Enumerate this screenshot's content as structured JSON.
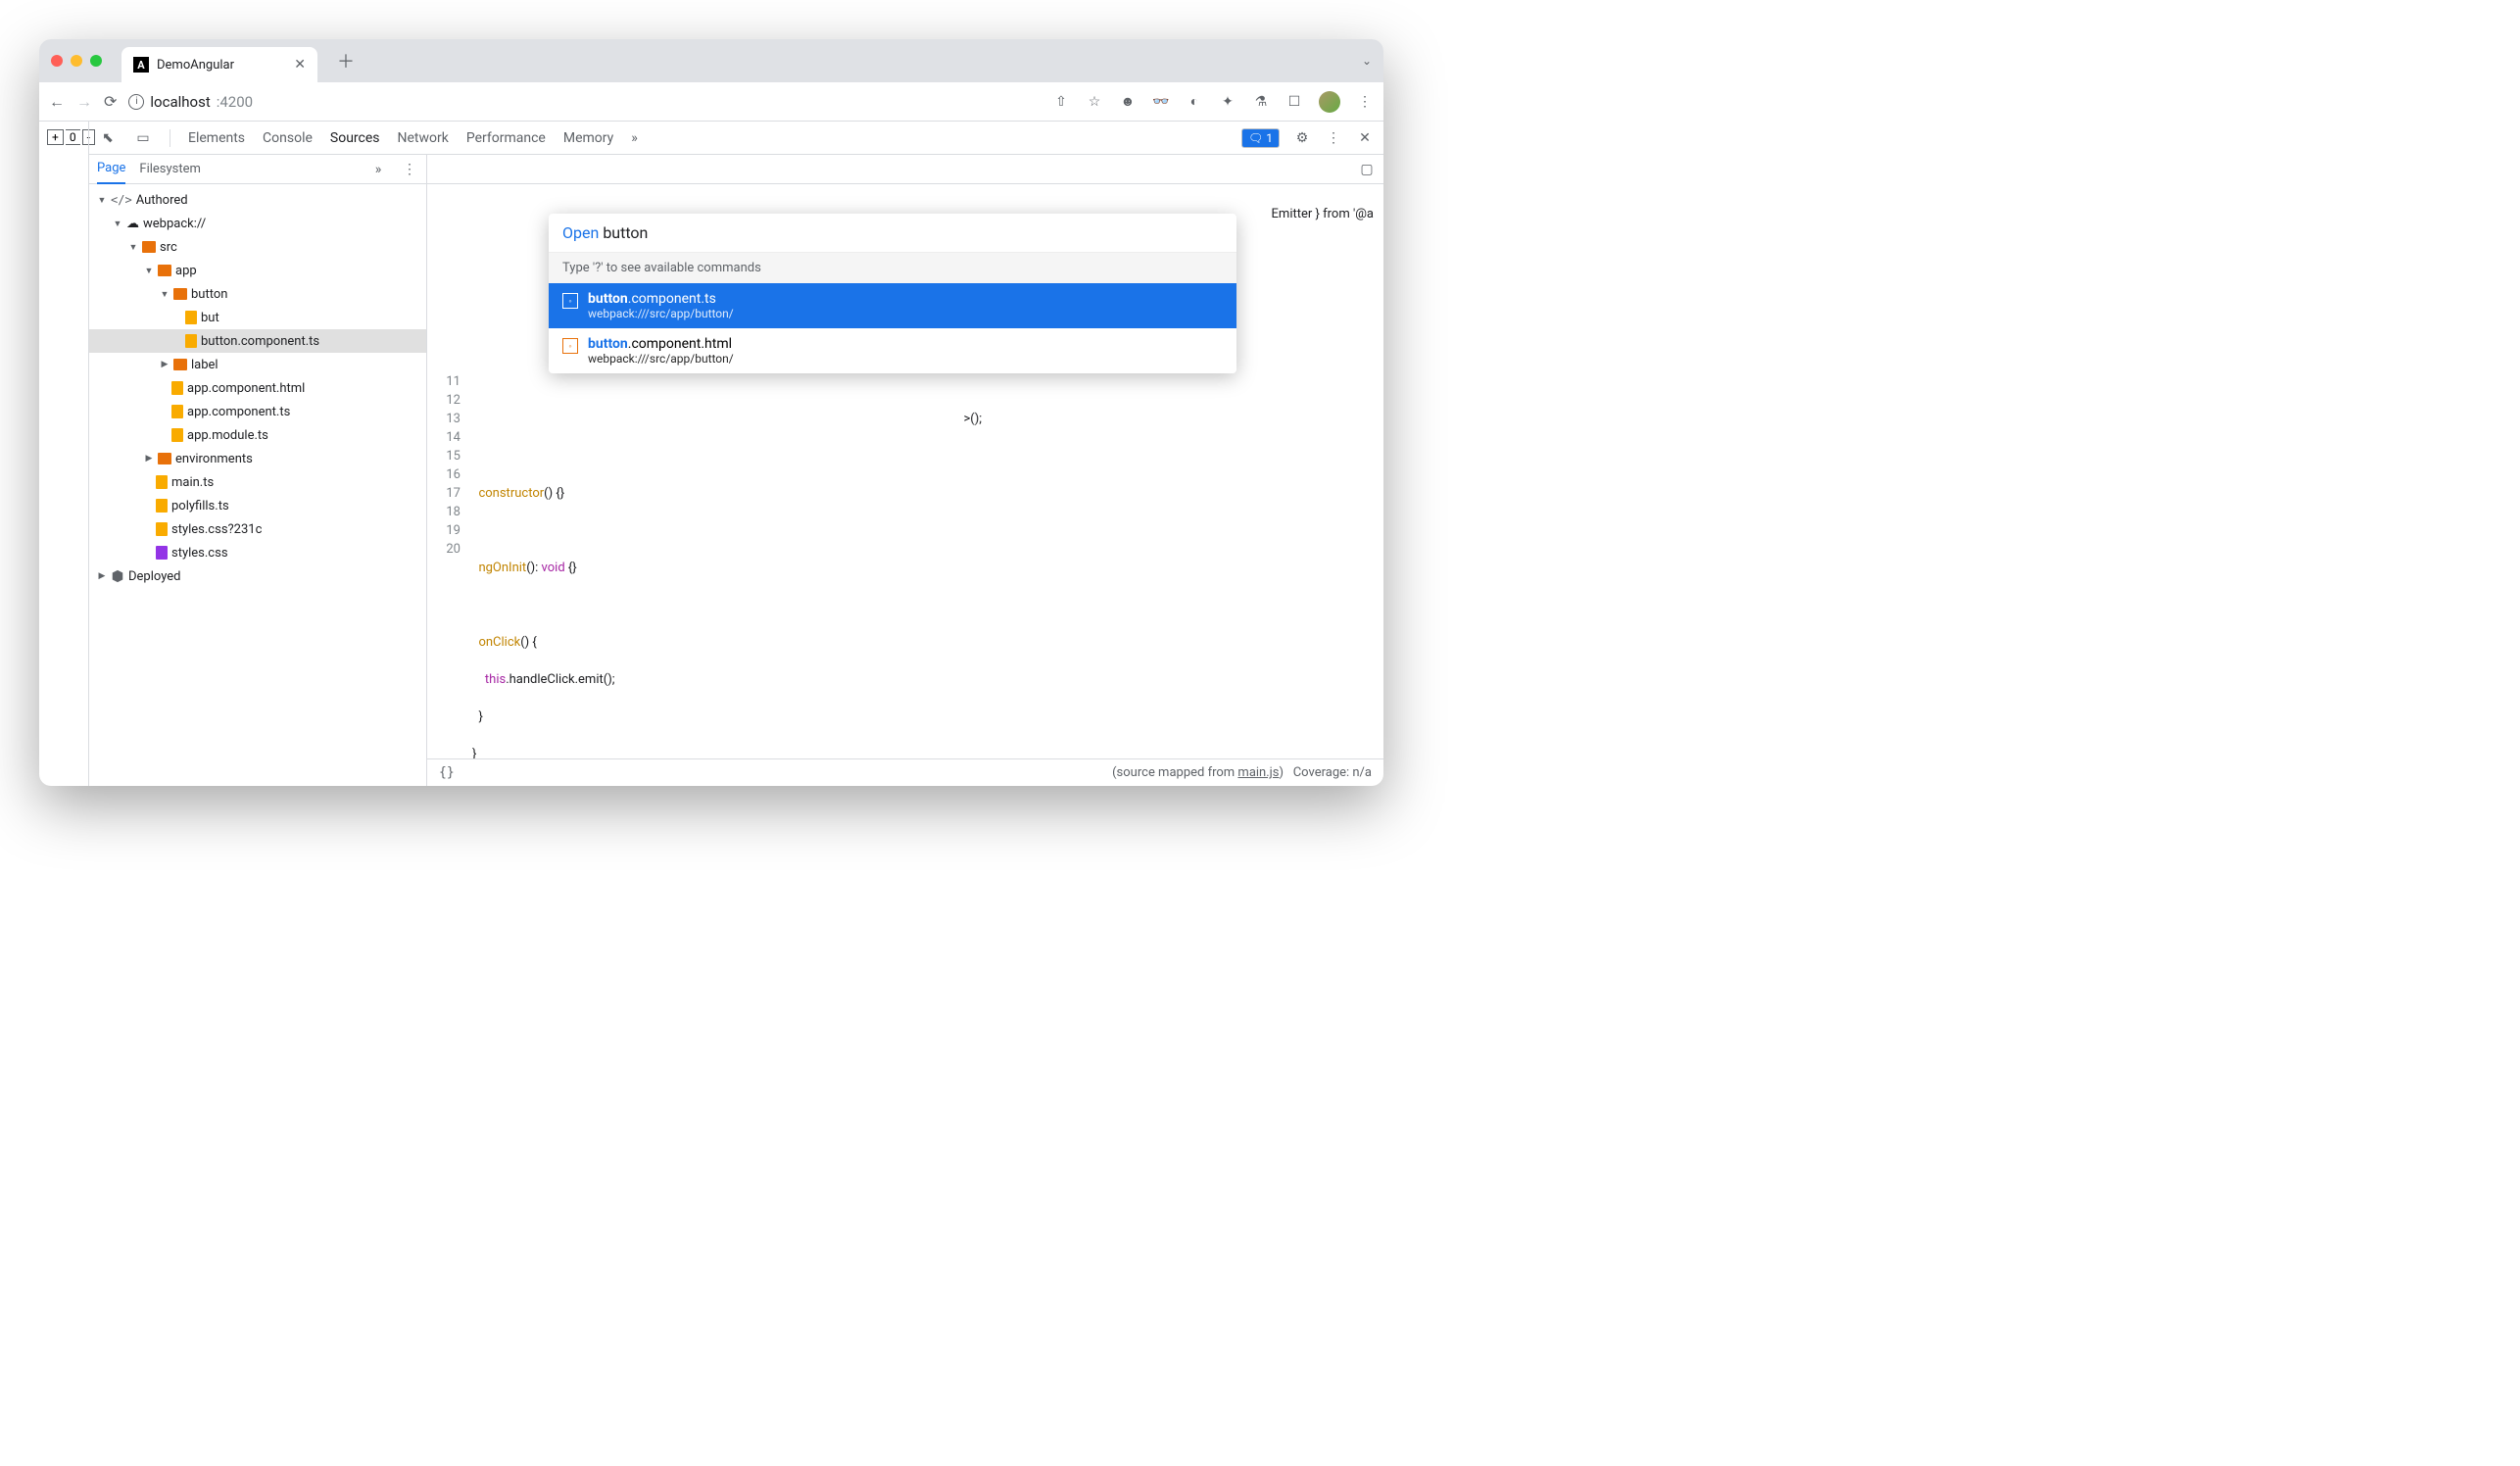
{
  "browser": {
    "tab_title": "DemoAngular",
    "url_host": "localhost",
    "url_port": ":4200"
  },
  "page_buttons": {
    "plus": "+",
    "zero": "0",
    "minus": "-"
  },
  "devtools": {
    "tabs": [
      "Elements",
      "Console",
      "Sources",
      "Network",
      "Performance",
      "Memory"
    ],
    "active_tab": "Sources",
    "issues_count": "1"
  },
  "sidebar_tabs": [
    "Page",
    "Filesystem"
  ],
  "tree": {
    "authored": "Authored",
    "webpack": "webpack://",
    "src": "src",
    "app": "app",
    "button_folder": "button",
    "file_short": "but",
    "file_selected": "button.component.ts",
    "label": "label",
    "app_html": "app.component.html",
    "app_ts": "app.component.ts",
    "app_module": "app.module.ts",
    "envs": "environments",
    "main": "main.ts",
    "poly": "polyfills.ts",
    "styles_q": "styles.css?231c",
    "styles": "styles.css",
    "deployed": "Deployed"
  },
  "open_dialog": {
    "label": "Open",
    "query": "button",
    "hint": "Type '?' to see available commands",
    "items": [
      {
        "name_prefix": "button",
        "name_rest": ".component.ts",
        "path": "webpack:///src/app/button/"
      },
      {
        "name_prefix": "button",
        "name_rest": ".component.html",
        "path": "webpack:///src/app/button/"
      }
    ]
  },
  "code": {
    "visible_fragment_top": "Emitter } from '@a",
    "ln11": "11",
    "ln12": "12",
    "ln13": "13",
    "ln14": "14",
    "ln15": "15",
    "ln16": "16",
    "ln17": "17",
    "ln18": "18",
    "ln19": "19",
    "ln20": "20",
    "l10_suffix": ">();",
    "l12_a": "constructor",
    "l12_b": "() {}",
    "l14_a": "ngOnInit",
    "l14_b": "(): ",
    "l14_c": "void",
    "l14_d": " {}",
    "l16_a": "onClick",
    "l16_b": "() {",
    "l17_a": "this",
    "l17_b": ".handleClick.emit();",
    "l18": "}",
    "l19": "}"
  },
  "footer": {
    "braces": "{}",
    "mapped_pre": "(source mapped from ",
    "mapped_link": "main.js",
    "mapped_post": ")",
    "coverage": "Coverage: n/a"
  }
}
